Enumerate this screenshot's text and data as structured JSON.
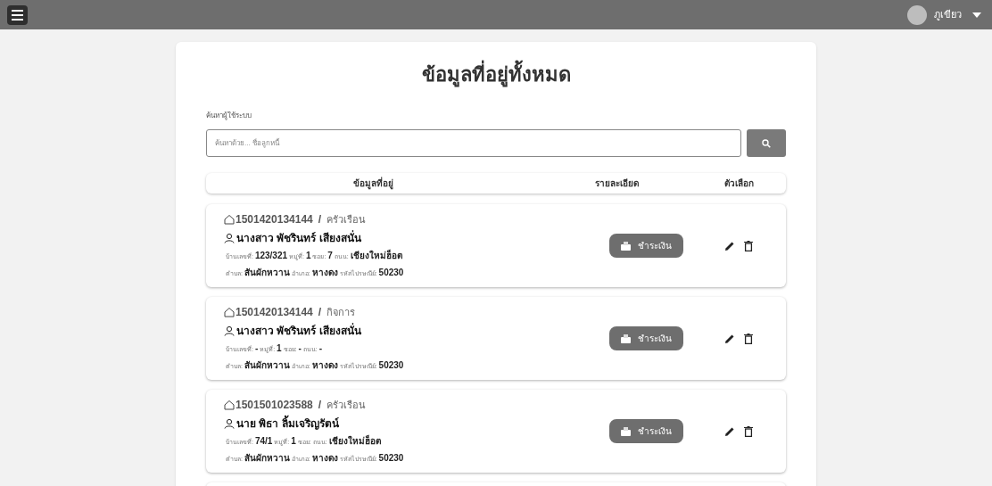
{
  "topbar": {
    "user_name": "ภูเขียว"
  },
  "title": "ข้อมูลที่อยู่ทั้งหมด",
  "search": {
    "label": "ค้นหาผู้ใช้ระบบ",
    "placeholder": "ค้นหาด้วย... ชื่อลูกหนี้"
  },
  "table": {
    "columns": [
      "ข้อมูลที่อยู่",
      "รายละเอียด",
      "ตัวเลือก"
    ],
    "rows": [
      {
        "code": "1501420134144",
        "separator": "/",
        "type": "ครัวเรือน",
        "name": "นางสาว พัชรินทร์ เสียงสนั่น",
        "address_line_1": "บ้านเลขที่: **123/321** หมู่ที่: **1** ซอย: **7** ถนน: **เชียงใหม่ฮ็อต**",
        "address_line_2": "ตำบล: **สันผักหวาน** อำเภอ: **หางดง** รหัสไปรษณีย์: **50230**",
        "pay_label": "ชำระเงิน"
      },
      {
        "code": "1501420134144",
        "separator": "/",
        "type": "กิจการ",
        "name": "นางสาว พัชรินทร์ เสียงสนั่น",
        "address_line_1": "บ้านเลขที่: **-** หมู่ที่: **1** ซอย: **-** ถนน: **-**",
        "address_line_2": "ตำบล: **สันผักหวาน** อำเภอ: **หางดง** รหัสไปรษณีย์: **50230**",
        "pay_label": "ชำระเงิน"
      },
      {
        "code": "1501501023588",
        "separator": "/",
        "type": "ครัวเรือน",
        "name": "นาย พิธา ลิ้มเจริญรัตน์",
        "address_line_1": "บ้านเลขที่: **74/1** หมู่ที่: **1** ซอย: ถนน: **เชียงใหม่ฮ็อต**",
        "address_line_2": "ตำบล: **สันผักหวาน** อำเภอ: **หางดง** รหัสไปรษณีย์: **50230**",
        "pay_label": "ชำระเงิน"
      }
    ]
  }
}
